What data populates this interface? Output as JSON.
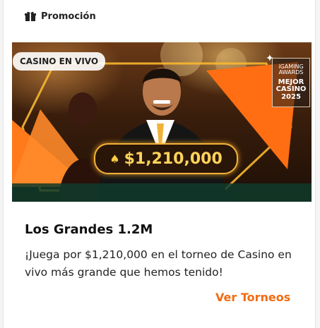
{
  "header": {
    "label": "Promoción",
    "icon": "gift-icon"
  },
  "banner": {
    "tag": "CASINO EN VIVO",
    "prize": "$1,210,000",
    "prize_icon": "crown-coin-icon",
    "award": {
      "line1": "iGAMING",
      "line2": "AWARDS",
      "line3": "MEJOR",
      "line4": "CASINO",
      "line5": "2025"
    },
    "accent": "#ff7a1a",
    "gold": "#f2b13a"
  },
  "promo": {
    "title": "Los Grandes 1.2M",
    "description": "¡Juega por $1,210,000 en el torneo de Casino en vivo más grande que hemos tenido!",
    "cta": "Ver Torneos",
    "cta_color": "#f26b12"
  }
}
